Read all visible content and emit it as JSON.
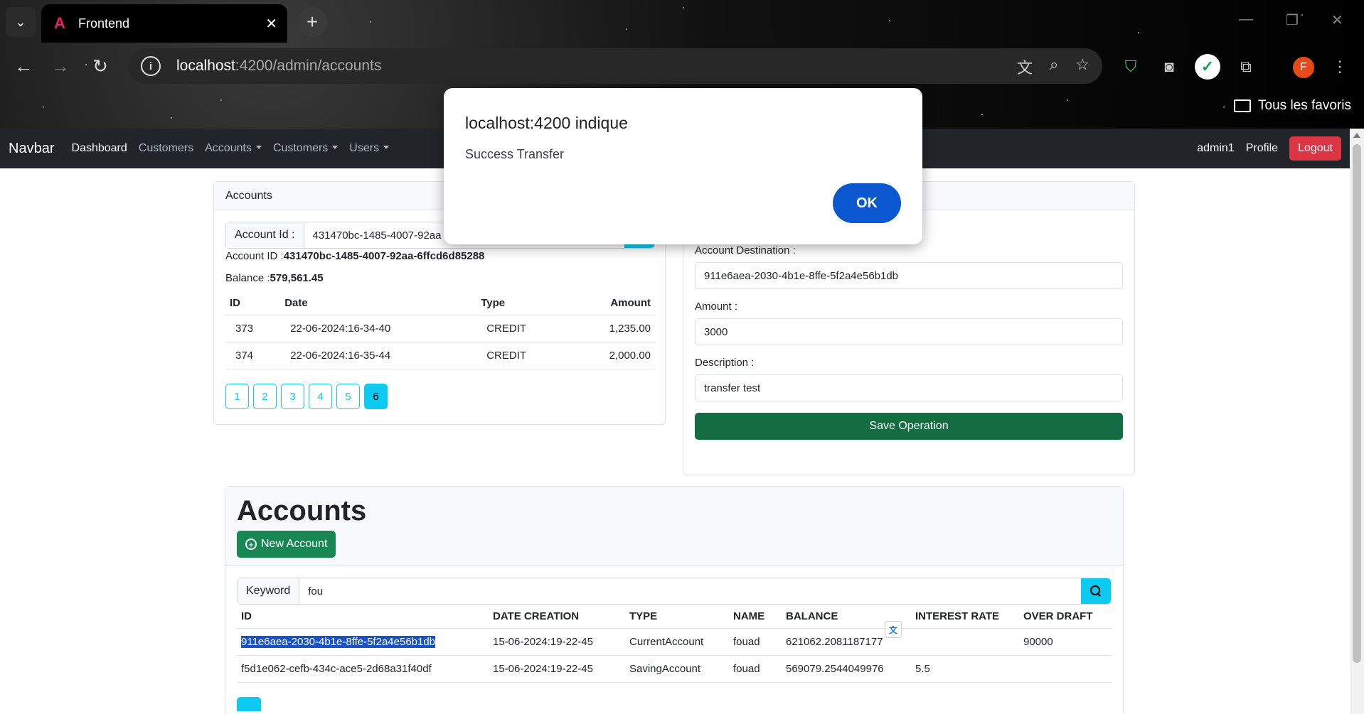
{
  "browser": {
    "tab_title": "Frontend",
    "url_host": "localhost",
    "url_path": ":4200/admin/accounts",
    "favorites_label": "Tous les favoris",
    "avatar_letter": "F"
  },
  "navbar": {
    "brand": "Navbar",
    "links": [
      "Dashboard",
      "Customers",
      "Accounts",
      "Customers",
      "Users"
    ],
    "user": "admin1",
    "profile": "Profile",
    "logout": "Logout"
  },
  "accounts_card": {
    "header": "Accounts",
    "account_id_label": "Account Id :",
    "account_id_value": "431470bc-1485-4007-92aa",
    "account_info_label": "Account ID :",
    "account_info_value": "431470bc-1485-4007-92aa-6ffcd6d85288",
    "balance_label": "Balance :",
    "balance_value": "579,561.45",
    "columns": [
      "ID",
      "Date",
      "Type",
      "Amount"
    ],
    "rows": [
      {
        "id": "373",
        "date": "22-06-2024:16-34-40",
        "type": "CREDIT",
        "amount": "1,235.00"
      },
      {
        "id": "374",
        "date": "22-06-2024:16-35-44",
        "type": "CREDIT",
        "amount": "2,000.00"
      }
    ],
    "pages": [
      "1",
      "2",
      "3",
      "4",
      "5",
      "6"
    ],
    "active_page": "6"
  },
  "operation_card": {
    "destination_label": "Account Destination :",
    "destination_value": "911e6aea-2030-4b1e-8ffe-5f2a4e56b1db",
    "amount_label": "Amount :",
    "amount_value": "3000",
    "description_label": "Description :",
    "description_value": "transfer test",
    "save_label": "Save Operation"
  },
  "accounts_list": {
    "title": "Accounts",
    "new_account_label": "New Account",
    "keyword_label": "Keyword",
    "keyword_value": "fou",
    "columns": [
      "ID",
      "DATE CREATION",
      "TYPE",
      "NAME",
      "BALANCE",
      "INTEREST RATE",
      "OVER DRAFT"
    ],
    "rows": [
      {
        "id": "911e6aea-2030-4b1e-8ffe-5f2a4e56b1db",
        "date": "15-06-2024:19-22-45",
        "type": "CurrentAccount",
        "name": "fouad",
        "balance": "621062.2081187177",
        "interest": "",
        "overdraft": "90000"
      },
      {
        "id": "f5d1e062-cefb-434c-ace5-2d68a31f40df",
        "date": "15-06-2024:19-22-45",
        "type": "SavingAccount",
        "name": "fouad",
        "balance": "569079.2544049976",
        "interest": "5.5",
        "overdraft": ""
      }
    ]
  },
  "dialog": {
    "title": "localhost:4200 indique",
    "message": "Success Transfer",
    "ok_label": "OK"
  },
  "colors": {
    "navbar_bg": "#212529",
    "logout": "#dc3545",
    "info": "#0dcaf0",
    "save": "#146c43",
    "new_account": "#198754",
    "dialog_ok": "#0b57d0"
  }
}
